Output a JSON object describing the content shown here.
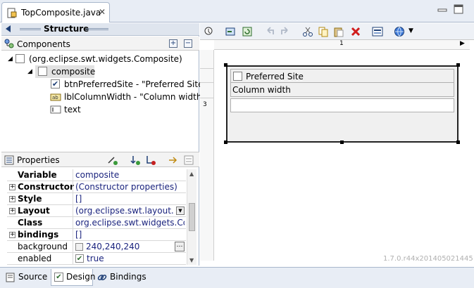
{
  "editor": {
    "tab_title": "TopComposite.java",
    "close_glyph": "✕"
  },
  "structure": {
    "title": "Structure"
  },
  "components": {
    "title": "Components",
    "items": [
      {
        "label": "(org.eclipse.swt.widgets.Composite)",
        "checked": false
      },
      {
        "label": "composite",
        "checked": false
      },
      {
        "label": "btnPreferredSite - \"Preferred Site\"",
        "checked": true
      },
      {
        "label": "lblColumnWidth - \"Column width\""
      },
      {
        "label": "text"
      }
    ]
  },
  "properties": {
    "title": "Properties",
    "rows": [
      {
        "name": "Variable",
        "value": "composite",
        "bold": true,
        "expandable": false
      },
      {
        "name": "Constructor",
        "value": "(Constructor properties)",
        "bold": true,
        "expandable": true
      },
      {
        "name": "Style",
        "value": "[]",
        "bold": true,
        "expandable": true
      },
      {
        "name": "Layout",
        "value": "(org.eclipse.swt.layout.G...",
        "bold": true,
        "expandable": true
      },
      {
        "name": "Class",
        "value": "org.eclipse.swt.widgets.Co...",
        "bold": true,
        "expandable": false
      },
      {
        "name": "bindings",
        "value": "[]",
        "bold": true,
        "expandable": true
      },
      {
        "name": "background",
        "value": "240,240,240",
        "bold": false,
        "expandable": false
      },
      {
        "name": "enabled",
        "value": "true",
        "bold": false,
        "expandable": false
      }
    ]
  },
  "canvas": {
    "ruler_top_label": "1",
    "ruler_left_label": "3",
    "checkbox_label": "Preferred Site",
    "column_label": "Column width",
    "version": "1.7.0.r44x201405021445"
  },
  "bottom_tabs": [
    {
      "label": "Source"
    },
    {
      "label": "Design"
    },
    {
      "label": "Bindings"
    }
  ],
  "colors": {
    "accent": "#1e3f76",
    "selected_row": "#e2e2e2",
    "tab_bg": "#e8edf5"
  }
}
